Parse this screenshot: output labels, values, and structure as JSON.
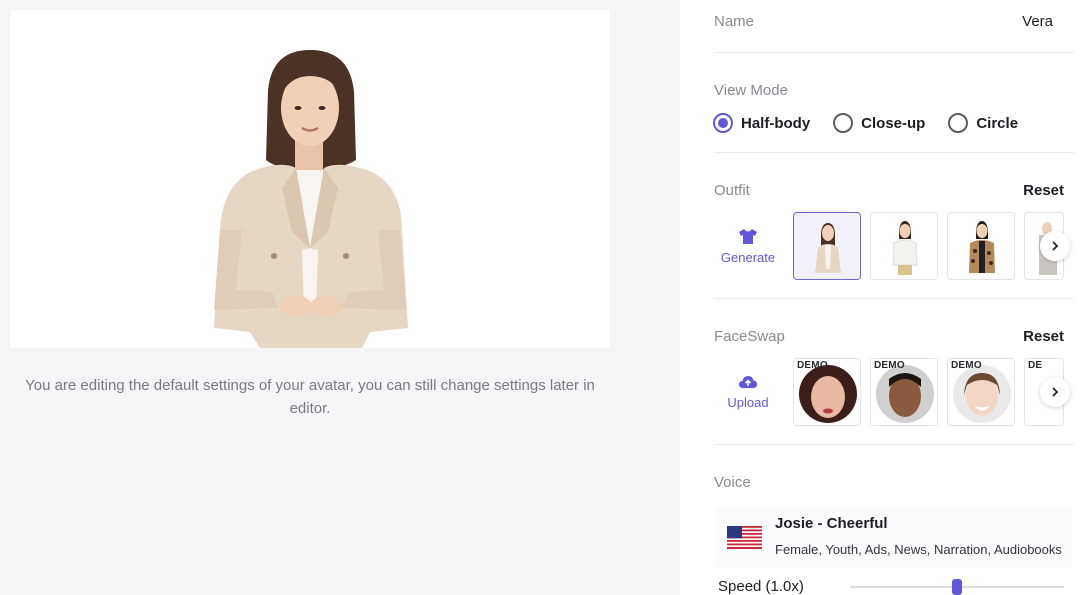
{
  "preview": {
    "hint": "You are editing the default settings of your avatar, you can still change settings later in editor."
  },
  "name": {
    "label": "Name",
    "value": "Vera"
  },
  "view_mode": {
    "label": "View Mode",
    "options": [
      "Half-body",
      "Close-up",
      "Circle"
    ],
    "selected": "Half-body"
  },
  "outfit": {
    "label": "Outfit",
    "reset_label": "Reset",
    "generate_label": "Generate",
    "thumbnails": [
      "beige-blazer-outfit",
      "white-top-outfit",
      "leopard-cardigan-outfit",
      "grey-outfit-partial"
    ],
    "selected_index": 0
  },
  "faceswap": {
    "label": "FaceSwap",
    "reset_label": "Reset",
    "upload_label": "Upload",
    "demo_tag": "DEMO",
    "demo_tag_partial": "DE",
    "faces": [
      "demo-face-woman-1",
      "demo-face-man",
      "demo-face-woman-2",
      "demo-face-partial"
    ]
  },
  "voice": {
    "label": "Voice",
    "name": "Josie - Cheerful",
    "tags": "Female, Youth, Ads, News, Narration, Audiobooks",
    "flag": "us-flag-icon"
  },
  "speed": {
    "label": "Speed (1.0x)",
    "value": 1.0
  },
  "colors": {
    "accent": "#6257d9",
    "muted": "#8a8a92",
    "text": "#1e1e24"
  }
}
